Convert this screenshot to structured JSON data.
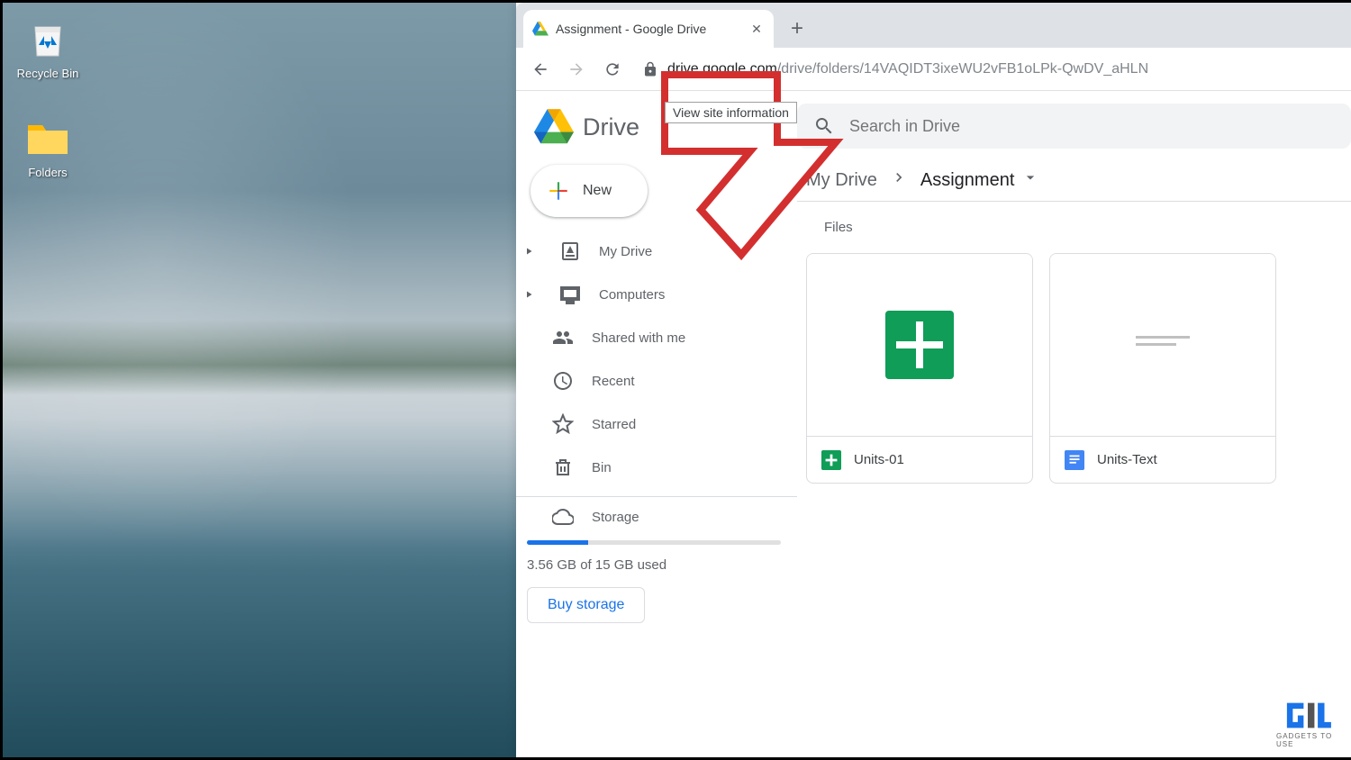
{
  "desktop": {
    "recycle_bin_label": "Recycle Bin",
    "folders_label": "Folders"
  },
  "browser": {
    "tab_title": "Assignment - Google Drive",
    "url_dark": "drive.google.com",
    "url_light": "/drive/folders/14VAQIDT3ixeWU2vFB1oLPk-QwDV_aHLN",
    "tooltip": "View site information"
  },
  "drive": {
    "logo_text": "Drive",
    "new_button": "New",
    "search_placeholder": "Search in Drive",
    "nav": {
      "my_drive": "My Drive",
      "computers": "Computers",
      "shared": "Shared with me",
      "recent": "Recent",
      "starred": "Starred",
      "bin": "Bin",
      "storage": "Storage"
    },
    "storage_used_text": "3.56 GB of 15 GB used",
    "storage_percent": 24,
    "buy_storage": "Buy storage"
  },
  "breadcrumb": {
    "root": "My Drive",
    "current": "Assignment"
  },
  "files": {
    "section_label": "Files",
    "items": [
      {
        "name": "Units-01",
        "type": "sheets"
      },
      {
        "name": "Units-Text",
        "type": "docs"
      }
    ]
  },
  "watermark": "GADGETS TO USE"
}
